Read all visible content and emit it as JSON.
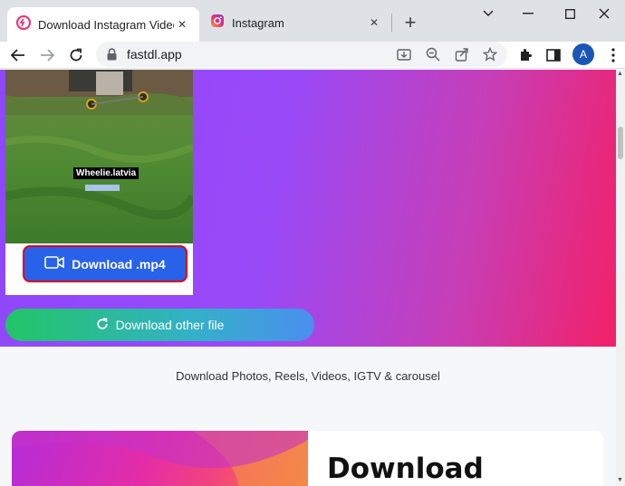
{
  "browser": {
    "tabs": [
      {
        "title": "Download Instagram Video, ",
        "icon": "fastdl-icon",
        "active": true
      },
      {
        "title": "Instagram",
        "icon": "instagram-icon",
        "active": false
      }
    ],
    "url": "fastdl.app",
    "profile_initial": "A"
  },
  "video": {
    "overlay_label": "Wheelie.latvia",
    "download_label": "Download .mp4"
  },
  "download_other_label": "Download other file",
  "tagline": "Download Photos, Reels, Videos, IGTV & carousel",
  "promo": {
    "title": "Download"
  },
  "colors": {
    "accent_blue": "#2762e9",
    "highlight_red": "#e1001a",
    "gradient_start": "#8e47fb",
    "gradient_end": "#f32068"
  }
}
